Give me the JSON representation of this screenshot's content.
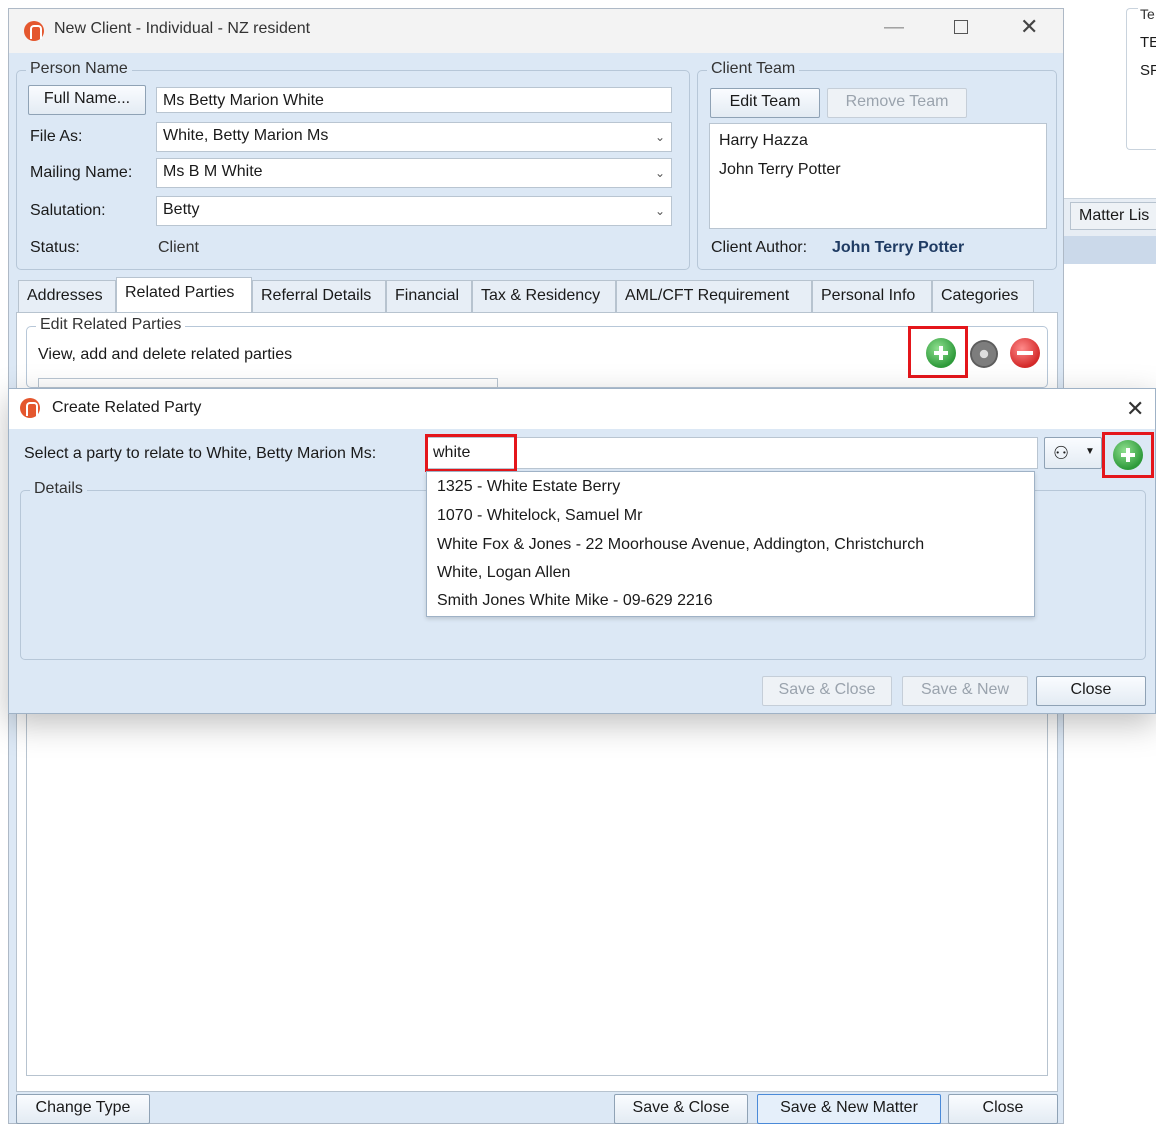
{
  "background": {
    "group_title": "Te",
    "line1": "TE",
    "line2": "SF",
    "matter_list_button": "Matter Lis"
  },
  "window": {
    "title": "New Client - Individual - NZ resident",
    "minimize_glyph": "—",
    "close_glyph": "✕"
  },
  "person_name": {
    "group_label": "Person Name",
    "full_name_button": "Full Name...",
    "full_name_value": "Ms Betty Marion White",
    "file_as_label": "File As:",
    "file_as_value": "White, Betty Marion Ms",
    "mailing_name_label": "Mailing Name:",
    "mailing_name_value": "Ms B M White",
    "salutation_label": "Salutation:",
    "salutation_value": "Betty",
    "status_label": "Status:",
    "status_value": "Client"
  },
  "client_team": {
    "group_label": "Client Team",
    "edit_team_button": "Edit Team",
    "remove_team_button": "Remove Team",
    "members": [
      "Harry Hazza",
      "John Terry Potter"
    ],
    "author_label": "Client Author:",
    "author_value": "John Terry Potter"
  },
  "tabs": [
    {
      "label": "Addresses"
    },
    {
      "label": "Related Parties"
    },
    {
      "label": "Referral Details"
    },
    {
      "label": "Financial"
    },
    {
      "label": "Tax & Residency"
    },
    {
      "label": "AML/CFT Requirement"
    },
    {
      "label": "Personal Info"
    },
    {
      "label": "Categories"
    }
  ],
  "related_parties": {
    "group_label": "Edit Related Parties",
    "description": "View, add and delete related parties"
  },
  "dialog": {
    "title": "Create Related Party",
    "close_glyph": "✕",
    "select_label": "Select a party to relate to White, Betty Marion Ms:",
    "search_value": "white",
    "details_label": "Details",
    "suggestions": [
      "1325 - White Estate Berry",
      "1070 - Whitelock, Samuel Mr",
      "White Fox & Jones - 22 Moorhouse Avenue, Addington, Christchurch",
      "White, Logan Allen",
      "Smith Jones White Mike - 09-629 2216"
    ],
    "save_close_button": "Save & Close",
    "save_new_button": "Save & New",
    "close_button": "Close"
  },
  "footer": {
    "change_type_button": "Change Type",
    "save_close_button": "Save & Close",
    "save_new_matter_button": "Save & New Matter",
    "close_button": "Close"
  },
  "colors": {
    "highlight_box": "#e4161b",
    "window_bg": "#dce8f5",
    "author_name": "#1f3b63"
  }
}
